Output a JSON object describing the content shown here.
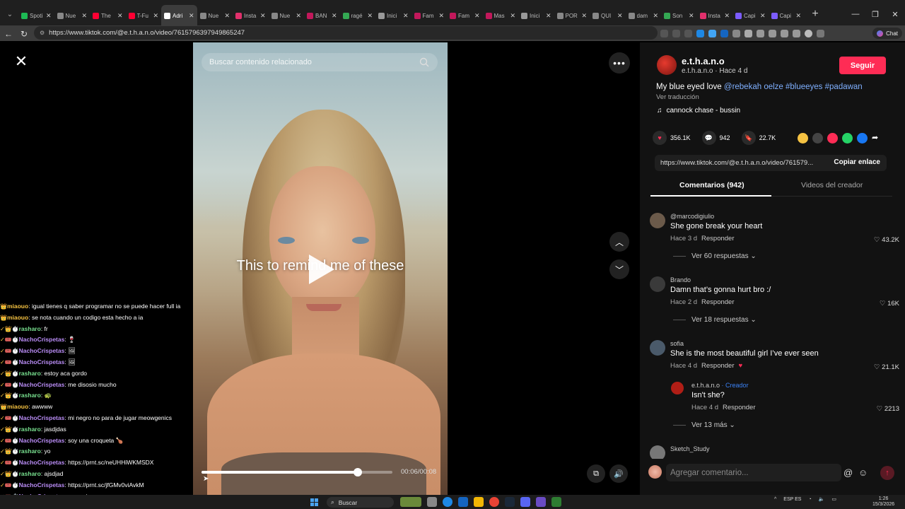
{
  "browser": {
    "tabs": [
      {
        "label": "Spoti",
        "color": "#1db954"
      },
      {
        "label": "Nue",
        "color": "#888888"
      },
      {
        "label": "The",
        "color": "#ff0033"
      },
      {
        "label": "T-Fu",
        "color": "#ff0033"
      },
      {
        "label": "Adri",
        "color": "#ffffff",
        "active": true
      },
      {
        "label": "Nue",
        "color": "#888888"
      },
      {
        "label": "Insta",
        "color": "#e1306c"
      },
      {
        "label": "Nue",
        "color": "#888888"
      },
      {
        "label": "BAN",
        "color": "#c2185b"
      },
      {
        "label": "ragé",
        "color": "#34a853"
      },
      {
        "label": "Inici",
        "color": "#999999"
      },
      {
        "label": "Fam",
        "color": "#c2185b"
      },
      {
        "label": "Fam",
        "color": "#c2185b"
      },
      {
        "label": "Mas",
        "color": "#c2185b"
      },
      {
        "label": "Inici",
        "color": "#999999"
      },
      {
        "label": "POR",
        "color": "#888888"
      },
      {
        "label": "QUI",
        "color": "#888888"
      },
      {
        "label": "dam",
        "color": "#888888"
      },
      {
        "label": "Son",
        "color": "#34a853"
      },
      {
        "label": "Insta",
        "color": "#e1306c"
      },
      {
        "label": "Capi",
        "color": "#7c5cff"
      },
      {
        "label": "Capi",
        "color": "#7c5cff"
      }
    ],
    "url": "https://www.tiktok.com/@e.t.h.a.n.o/video/7615796397949865247",
    "chat_button": "Chat"
  },
  "video": {
    "search_placeholder": "Buscar contenido relacionado",
    "caption": "This to remind me of these",
    "timecode": "00:06/00:08",
    "progress": 0.82
  },
  "chat": [
    {
      "user": "miaouo",
      "cls": "u3",
      "badges": "👑",
      "text": "igual tienes q saber programar no se puede hacer full ia"
    },
    {
      "user": "miaouo",
      "cls": "u3",
      "badges": "👑",
      "text": "se nota cuando un codigo esta hecho a ia"
    },
    {
      "user": "rasharo",
      "cls": "u2",
      "badges": "✓👑⏱️",
      "text": "fr"
    },
    {
      "user": "NachoCrispetas",
      "cls": "u1",
      "badges": "✓🎟️⏱️",
      "text": "🍷"
    },
    {
      "user": "NachoCrispetas",
      "cls": "u1",
      "badges": "✓🎟️⏱️",
      "text": "🖼"
    },
    {
      "user": "NachoCrispetas",
      "cls": "u1",
      "badges": "✓🎟️⏱️",
      "text": "🖼"
    },
    {
      "user": "rasharo",
      "cls": "u2",
      "badges": "✓👑⏱️",
      "text": "estoy aca gordo"
    },
    {
      "user": "NachoCrispetas",
      "cls": "u1",
      "badges": "✓🎟️⏱️",
      "text": "me disosio mucho"
    },
    {
      "user": "rasharo",
      "cls": "u2",
      "badges": "✓👑⏱️",
      "text": "🐢"
    },
    {
      "user": "miaouo",
      "cls": "u3",
      "badges": "👑",
      "text": "awwww"
    },
    {
      "user": "NachoCrispetas",
      "cls": "u1",
      "badges": "✓🎟️⏱️",
      "text": "mi negro no para de jugar meowgenics"
    },
    {
      "user": "rasharo",
      "cls": "u2",
      "badges": "✓👑⏱️",
      "text": "jasdjdas"
    },
    {
      "user": "NachoCrispetas",
      "cls": "u1",
      "badges": "✓🎟️⏱️",
      "text": "soy una croqueta 🍗"
    },
    {
      "user": "rasharo",
      "cls": "u2",
      "badges": "✓👑⏱️",
      "text": "yo"
    },
    {
      "user": "NachoCrispetas",
      "cls": "u1",
      "badges": "✓🎟️⏱️",
      "text": "https://prnt.sc/neUHHiWKMSDX"
    },
    {
      "user": "rasharo",
      "cls": "u2",
      "badges": "✓👑⏱️",
      "text": "ajsdjad"
    },
    {
      "user": "NachoCrispetas",
      "cls": "u1",
      "badges": "✓🎟️⏱️",
      "text": "https://prnt.sc/jfGMv0viAvkM"
    },
    {
      "user": "NachoCrispetas",
      "cls": "u1",
      "badges": "✓🎟️⏱️",
      "text": "una asi"
    }
  ],
  "post": {
    "author": "e.t.h.a.n.o",
    "author_sub": "e.t.h.a.n.o · Hace 4 d",
    "follow": "Seguir",
    "desc_text": "My blue eyed love ",
    "desc_tags": "@rebekah oelze #blueeyes #padawan",
    "translate": "Ver traducción",
    "music": "cannock chase - bussin",
    "likes": "356.1K",
    "comments": "942",
    "saves": "22.7K",
    "link": "https://www.tiktok.com/@e.t.h.a.n.o/video/761579...",
    "copy": "Copiar enlace",
    "tab_comments": "Comentarios (942)",
    "tab_videos": "Videos del creador"
  },
  "comments": [
    {
      "user": "@marcodigiulio",
      "text": "She gone break your heart",
      "meta": "Hace 3 d",
      "reply": "Responder",
      "likes": "♡ 43.2K",
      "more": "Ver 60 respuestas ⌄",
      "avatar": "#6b5a4a"
    },
    {
      "user": "Brando",
      "text": "Damn that’s gonna hurt bro :/",
      "meta": "Hace 2 d",
      "reply": "Responder",
      "likes": "♡ 16K",
      "more": "Ver 18 respuestas ⌄",
      "avatar": "#3a3a3a"
    },
    {
      "user": "sofia",
      "text": "She is the most beautiful girl I’ve ever seen",
      "meta": "Hace 4 d",
      "reply": "Responder",
      "likes": "♡ 21.1K",
      "avatar": "#4a5a6a"
    },
    {
      "user": "e.t.h.a.n.o",
      "creator": "· Creador",
      "text": "Isn't she?",
      "meta": "Hace 4 d",
      "reply": "Responder",
      "likes": "♡ 2213",
      "more": "Ver 13 más ⌄",
      "avatar": "#b01e16"
    },
    {
      "user": "Sketch_Study",
      "avatar": "#777777"
    }
  ],
  "comment_input": {
    "placeholder": "Agregar comentario..."
  },
  "taskbar": {
    "search": "Buscar",
    "lang": "ESP ES",
    "time": "1:26",
    "date": "15/3/2026"
  }
}
